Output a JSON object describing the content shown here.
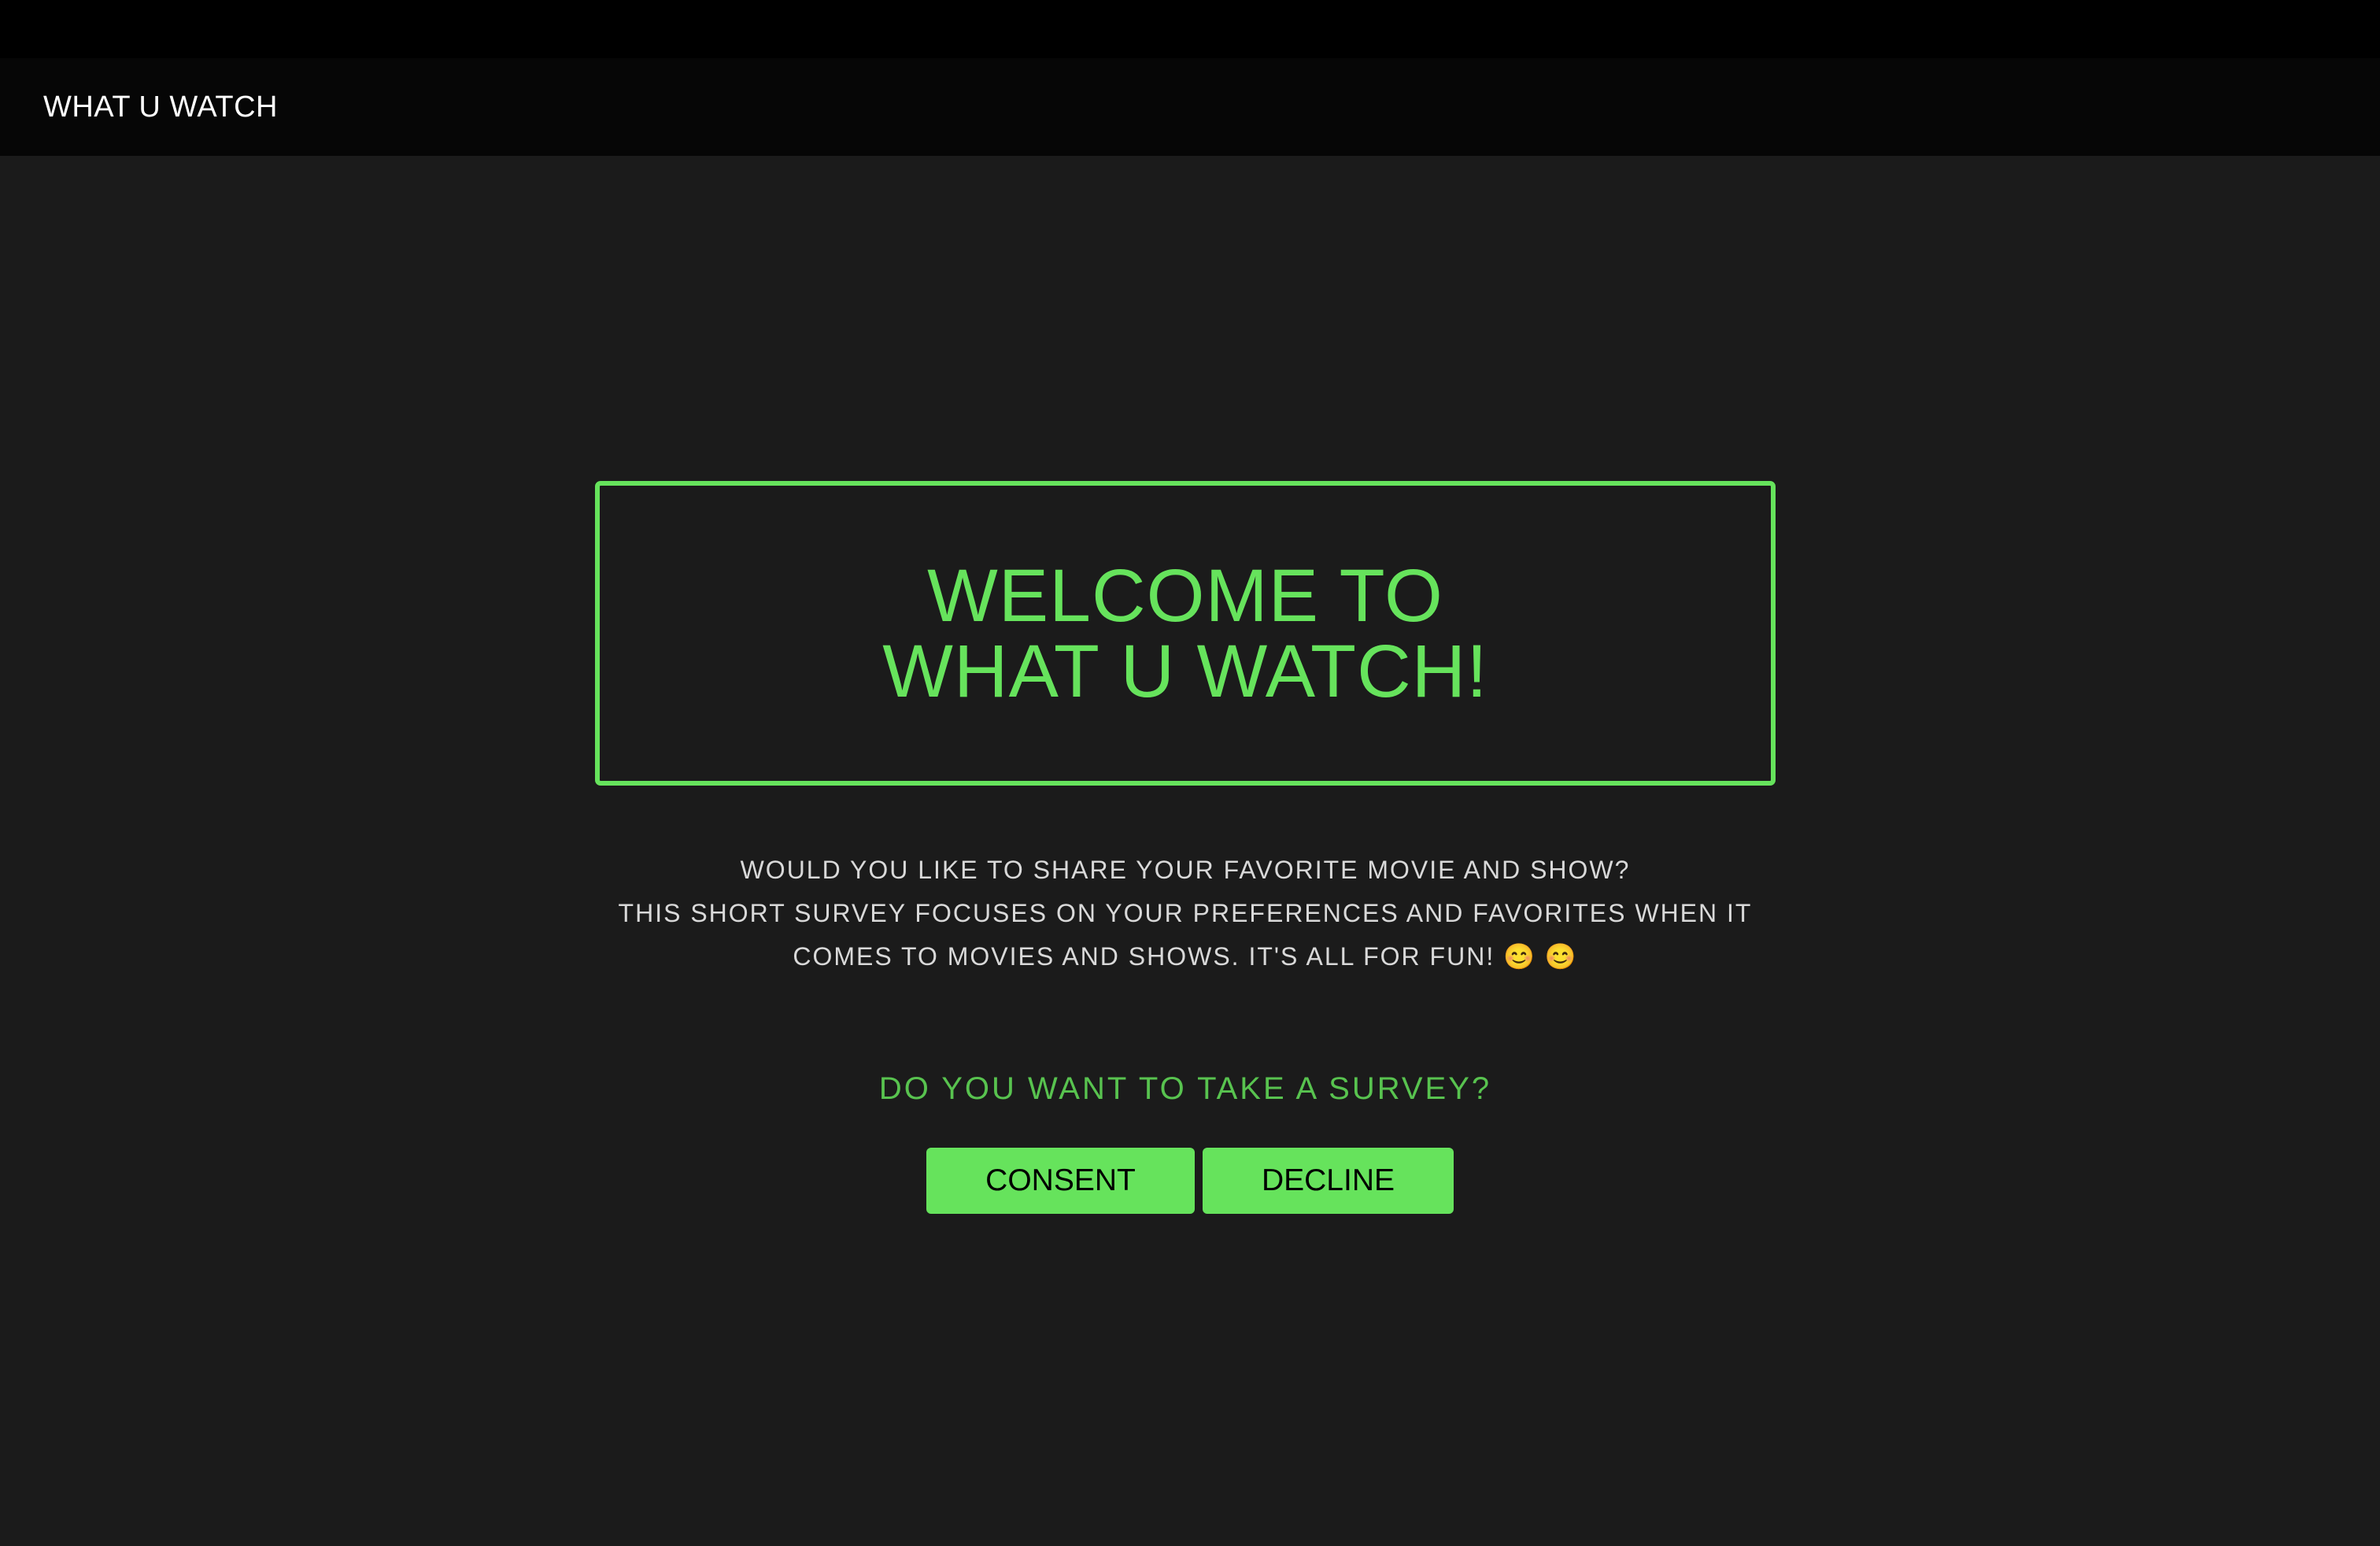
{
  "navbar": {
    "brand": "WHAT U WATCH"
  },
  "welcome": {
    "line1": "WELCOME TO",
    "line2": "WHAT U WATCH!"
  },
  "intro": {
    "line1": "WOULD YOU LIKE TO SHARE YOUR FAVORITE MOVIE AND SHOW?",
    "line2": "THIS SHORT SURVEY FOCUSES ON YOUR PREFERENCES AND FAVORITES WHEN IT",
    "line3": "COMES TO MOVIES AND SHOWS. IT'S ALL FOR FUN! 😊 😊"
  },
  "survey": {
    "question": "DO YOU WANT TO TAKE A SURVEY?",
    "consent_label": "CONSENT",
    "decline_label": "DECLINE"
  },
  "colors": {
    "accent": "#66e35c",
    "question": "#58c34f",
    "background": "#1b1b1b",
    "navbar": "#060606"
  }
}
